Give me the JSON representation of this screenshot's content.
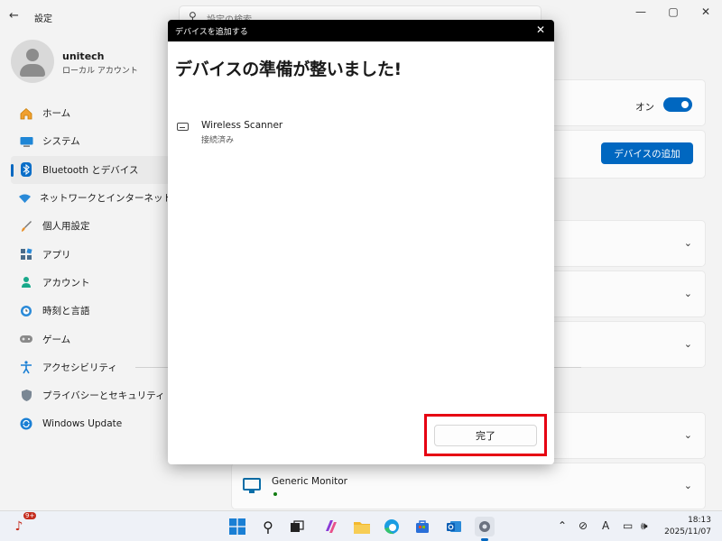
{
  "app": {
    "title": "設定",
    "search_placeholder": "設定の検索"
  },
  "window_controls": {
    "minimize": "—",
    "maximize": "▢",
    "close": "✕"
  },
  "profile": {
    "name": "unitech",
    "account_type": "ローカル アカウント"
  },
  "nav": [
    {
      "label": "ホーム",
      "icon": "home-icon"
    },
    {
      "label": "システム",
      "icon": "system-icon"
    },
    {
      "label": "Bluetooth とデバイス",
      "icon": "bluetooth-icon",
      "active": true
    },
    {
      "label": "ネットワークとインターネット",
      "icon": "network-icon"
    },
    {
      "label": "個人用設定",
      "icon": "brush-icon"
    },
    {
      "label": "アプリ",
      "icon": "apps-icon"
    },
    {
      "label": "アカウント",
      "icon": "account-icon"
    },
    {
      "label": "時刻と言語",
      "icon": "clock-globe-icon"
    },
    {
      "label": "ゲーム",
      "icon": "gamepad-icon"
    },
    {
      "label": "アクセシビリティ",
      "icon": "accessibility-icon"
    },
    {
      "label": "プライバシーとセキュリティ",
      "icon": "shield-icon"
    },
    {
      "label": "Windows Update",
      "icon": "update-icon"
    }
  ],
  "content": {
    "bluetooth_toggle_label": "オン",
    "add_device_button": "デバイスの追加",
    "generic_monitor": "Generic Monitor"
  },
  "dialog": {
    "title": "デバイスを追加する",
    "heading": "デバイスの準備が整いました!",
    "device_name": "Wireless Scanner",
    "device_status": "接続済み",
    "done_button": "完了"
  },
  "taskbar": {
    "notification_badge": "9+",
    "time": "18:13",
    "date": "2025/11/07",
    "ime_indicator": "A"
  },
  "colors": {
    "accent": "#0067c0",
    "highlight_frame": "#e60012"
  }
}
